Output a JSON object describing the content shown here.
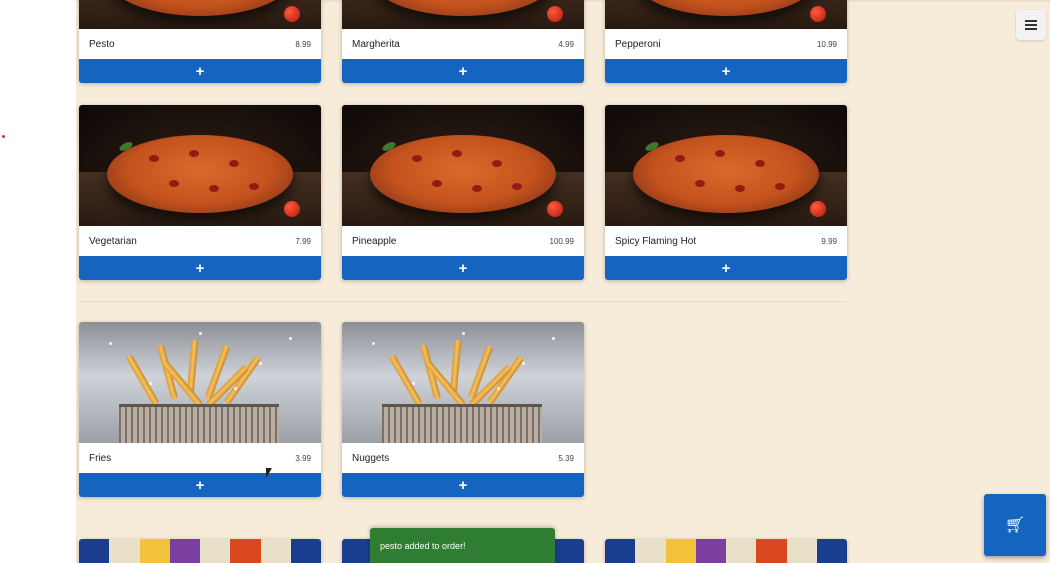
{
  "sections": {
    "pizzas": [
      {
        "name": "Pesto",
        "price": "8.99"
      },
      {
        "name": "Margherita",
        "price": "4.99"
      },
      {
        "name": "Pepperoni",
        "price": "10.99"
      },
      {
        "name": "Vegetarian",
        "price": "7.99"
      },
      {
        "name": "Pineapple",
        "price": "100.99"
      },
      {
        "name": "Spicy Flaming Hot",
        "price": "9.99"
      }
    ],
    "sides": [
      {
        "name": "Fries",
        "price": "3.99"
      },
      {
        "name": "Nuggets",
        "price": "5.39"
      }
    ]
  },
  "buttons": {
    "add_label": "+"
  },
  "toast": {
    "message": "pesto added to order!"
  },
  "icons": {
    "menu": "hamburger-menu-icon",
    "cart": "shopping-cart-icon"
  },
  "colors": {
    "accent_blue": "#1565c0",
    "toast_green": "#2e7d32",
    "page_background": "#f7ebd9"
  }
}
